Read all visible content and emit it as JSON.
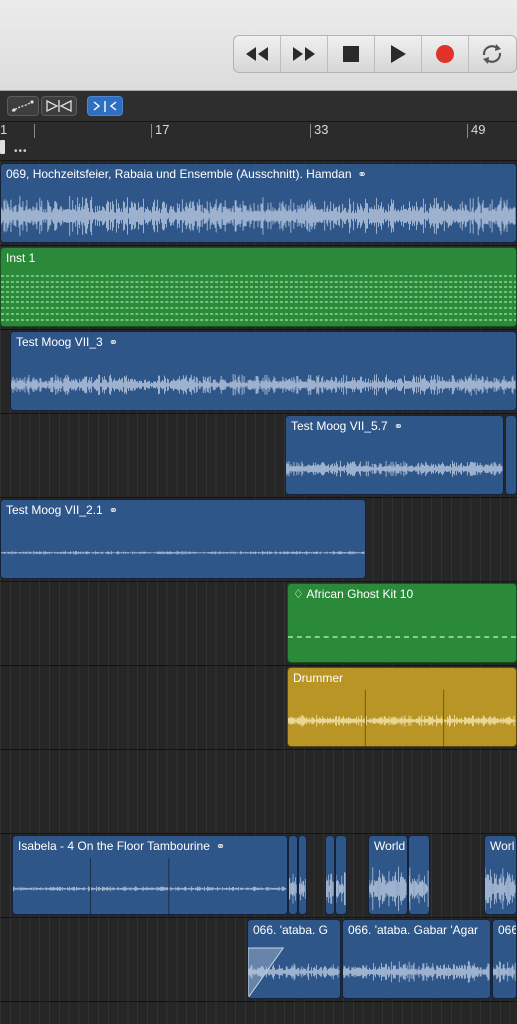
{
  "transport": {
    "buttons": [
      {
        "id": "rewind",
        "icon": "rewind-icon"
      },
      {
        "id": "forward",
        "icon": "fast-forward-icon"
      },
      {
        "id": "stop",
        "icon": "stop-icon"
      },
      {
        "id": "play",
        "icon": "play-icon"
      },
      {
        "id": "record",
        "icon": "record-icon"
      },
      {
        "id": "cycle",
        "icon": "cycle-icon"
      }
    ],
    "record_color": "#e0322b"
  },
  "ruler": {
    "labels": [
      "1",
      "17",
      "33",
      "49"
    ]
  },
  "regions": [
    {
      "name": "069, Hochzeitsfeier, Rabaia und Ensemble (Ausschnitt). Hamdan",
      "type": "audio",
      "loop": true
    },
    {
      "name": "Inst 1",
      "type": "midi",
      "loop": false
    },
    {
      "name": "Test Moog VII_3",
      "type": "audio",
      "loop": true
    },
    {
      "name": "Test Moog VII_5.7",
      "type": "audio",
      "loop": true
    },
    {
      "name": "Test Moog VII_2.1",
      "type": "audio",
      "loop": true
    },
    {
      "name": "♢ African Ghost Kit 10",
      "type": "midi",
      "loop": false
    },
    {
      "name": "Drummer",
      "type": "drum",
      "loop": false
    },
    {
      "name": "Isabela  -  4 On the Floor Tambourine",
      "type": "audio",
      "loop": true
    },
    {
      "name": "World M",
      "type": "audio",
      "loop": false
    },
    {
      "name": "Worl",
      "type": "audio",
      "loop": false
    },
    {
      "name": "066. 'ataba. G",
      "type": "audio",
      "loop": false
    },
    {
      "name": "066. 'ataba. Gabar 'Agar",
      "type": "audio",
      "loop": false
    },
    {
      "name": "066",
      "type": "audio",
      "loop": false
    }
  ],
  "colors": {
    "audio": "#2f5688",
    "midi": "#2b8a3a",
    "drummer": "#b89524",
    "accent": "#2f6fc1"
  }
}
